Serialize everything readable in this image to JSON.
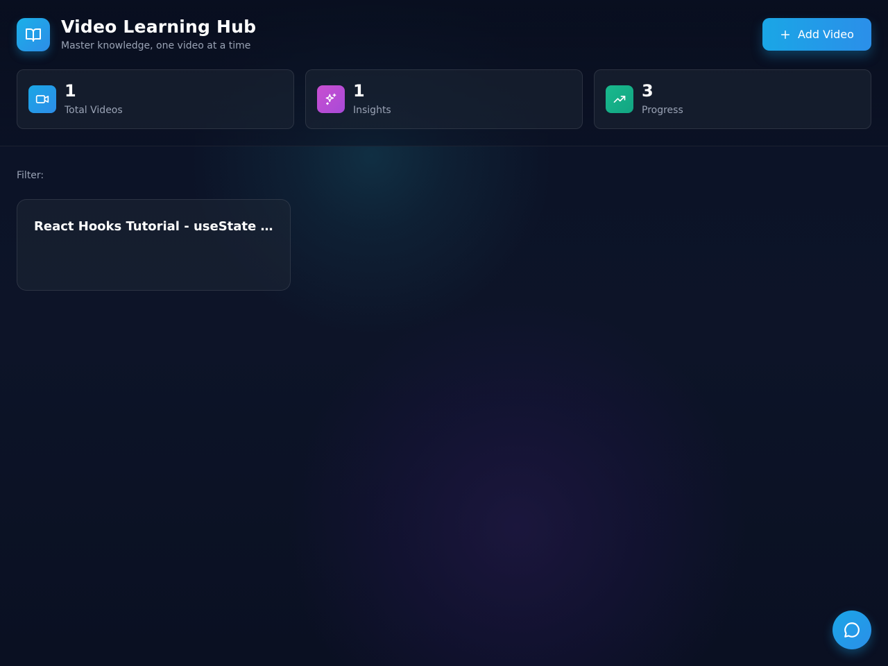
{
  "header": {
    "title": "Video Learning Hub",
    "subtitle": "Master knowledge, one video at a time",
    "logo_icon": "book-open-icon",
    "add_button_label": "Add Video"
  },
  "stats": [
    {
      "value": "1",
      "label": "Total Videos",
      "icon": "video-camera-icon",
      "color": "#2a9df0"
    },
    {
      "value": "1",
      "label": "Insights",
      "icon": "sparkles-icon",
      "color": "#c44fcf"
    },
    {
      "value": "3",
      "label": "Progress",
      "icon": "trending-up-icon",
      "color": "#16b48e"
    }
  ],
  "filter": {
    "label": "Filter:"
  },
  "videos": [
    {
      "title": "React Hooks Tutorial - useState and useEffect"
    }
  ],
  "chat": {
    "icon": "chat-bubble-icon"
  },
  "colors": {
    "accent": "#2a9df0",
    "background": "#0a1022",
    "muted_text": "#9aa3b5"
  }
}
